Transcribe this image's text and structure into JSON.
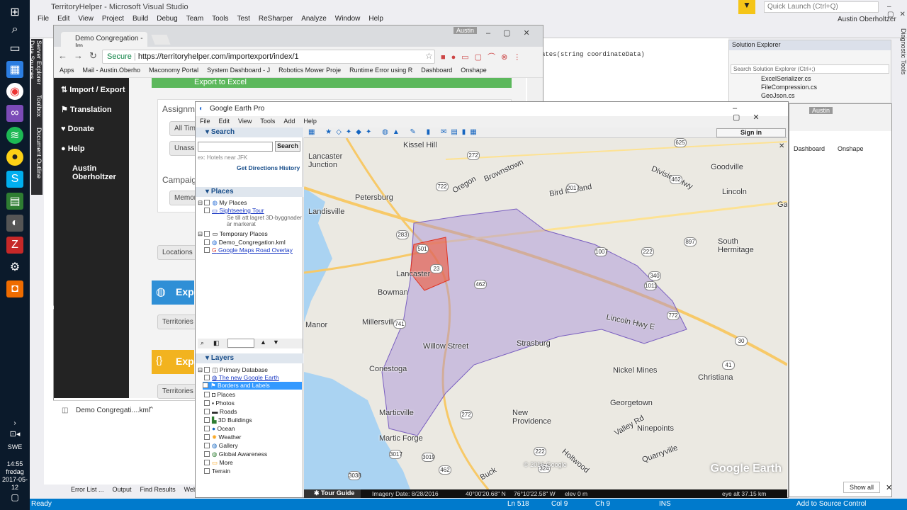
{
  "taskbar": {
    "lang": "SWE",
    "time": "14:55",
    "day": "fredag",
    "date": "2017-05-12"
  },
  "vs": {
    "title": "TerritoryHelper - Microsoft Visual Studio",
    "menu": [
      "File",
      "Edit",
      "View",
      "Project",
      "Build",
      "Debug",
      "Team",
      "Tools",
      "Test",
      "ReSharper",
      "Analyze",
      "Window",
      "Help"
    ],
    "quick_launch": "Quick Launch (Ctrl+Q)",
    "user": "Austin Oberholtzer",
    "side_tabs": [
      "Server Explorer",
      "Toolbox",
      "Document Outline",
      "Data Sources"
    ],
    "right_tab": "Diagnostic Tools",
    "code_snippet": "ates(string coordinateData)",
    "bottom_tabs": [
      "Error List ...",
      "Output",
      "Find Results",
      "Web Publish Activity"
    ],
    "status": {
      "ready": "Ready",
      "ln": "Ln 518",
      "col": "Col 9",
      "ch": "Ch 9",
      "ins": "INS",
      "source": "Add to Source Control"
    },
    "solution_explorer": {
      "title": "Solution Explorer",
      "search": "Search Solution Explorer (Ctrl+;)",
      "items": [
        "ExcelSerializer.cs",
        "FileCompression.cs",
        "GeoJson.cs"
      ]
    },
    "show_all": "Show all"
  },
  "chrome": {
    "user": "Austin",
    "tab": "Demo Congregation - Im",
    "secure": "Secure",
    "url": "https://territoryhelper.com/importexport/index/1",
    "bookmarks": [
      "Apps",
      "Mail - Austin.Oberho",
      "Maconomy Portal",
      "System Dashboard - J",
      "Robotics Mower Proje",
      "Runtime Error using R",
      "Dashboard",
      "Onshape"
    ],
    "nav": [
      "Import / Export",
      "Translation",
      "Donate",
      "Help",
      "Austin Oberholtzer"
    ],
    "main": {
      "export_excel": "Export to Excel",
      "assignments": "Assignme",
      "all_time": "All Time",
      "unassign": "Unassig",
      "campaign": "Campaig",
      "memorial": "Memori",
      "locations": "Locations",
      "export1": "Expo",
      "territories1": "Territories",
      "export2": "Expo",
      "territories2": "Territories",
      "percent": "100"
    },
    "download": "Demo Congregati....kml"
  },
  "chrome2": {
    "user": "Austin",
    "bookmarks": [
      "Dashboard",
      "Onshape"
    ]
  },
  "ge": {
    "title": "Google Earth Pro",
    "menu": [
      "File",
      "Edit",
      "View",
      "Tools",
      "Add",
      "Help"
    ],
    "search_hdr": "Search",
    "search_btn": "Search",
    "search_hint": "ex: Hotels near JFK",
    "get_directions": "Get Directions",
    "history": "History",
    "places_hdr": "Places",
    "places": [
      "My Places",
      "Sightseeing Tour",
      "Se till att lagret 3D-byggnader",
      "är markerat",
      "Temporary Places",
      "Demo_Congregation.kml",
      "Google Maps Road Overlay"
    ],
    "layers_hdr": "Layers",
    "layers": [
      "Primary Database",
      "The new Google Earth",
      "Borders and Labels",
      "Places",
      "Photos",
      "Roads",
      "3D Buildings",
      "Ocean",
      "Weather",
      "Gallery",
      "Global Awareness",
      "More",
      "Terrain"
    ],
    "sign_in": "Sign in",
    "tour_guide": "Tour Guide",
    "status": {
      "imagery": "Imagery Date: 8/28/2016",
      "lat": "40°00'20.68\" N",
      "lon": "76°10'22.58\" W",
      "elev": "elev    0 m",
      "eye": "eye alt  37.15 km"
    },
    "copyright": "© 2016 Google",
    "watermark": "Google Earth",
    "map_labels": [
      "Kissel Hill",
      "Lancaster Junction",
      "Oregon",
      "Brownstown",
      "Goodville",
      "Lincoln",
      "Petersburg",
      "Landisville",
      "Lancaster",
      "Millersville",
      "Willow Street",
      "Strasburg",
      "Conestoga",
      "Marticville",
      "New Providence",
      "Georgetown",
      "Nickel Mines",
      "Christiana",
      "Quarryville",
      "Ninepoints",
      "Martic Forge",
      "Holtwood",
      "Buck",
      "South Hermitage",
      "Manor",
      "Bowman",
      "Gap",
      "Bird in Hand",
      "Division Hwy",
      "Lincoln Hwy E",
      "Valley Rd"
    ],
    "shields": [
      "625",
      "272",
      "722",
      "772",
      "283",
      "501",
      "23",
      "462",
      "741",
      "222",
      "1007",
      "340",
      "1011",
      "897",
      "30",
      "41",
      "272",
      "324",
      "3017",
      "3019",
      "3038",
      "462",
      "2017",
      "222",
      "462"
    ]
  },
  "colors": {
    "accent": "#007acc",
    "th_blue": "#2f8fd6",
    "th_yellow": "#f2b31f",
    "th_dark": "#232323",
    "territory": "#a58bd8",
    "downtown": "#f05a3a"
  }
}
